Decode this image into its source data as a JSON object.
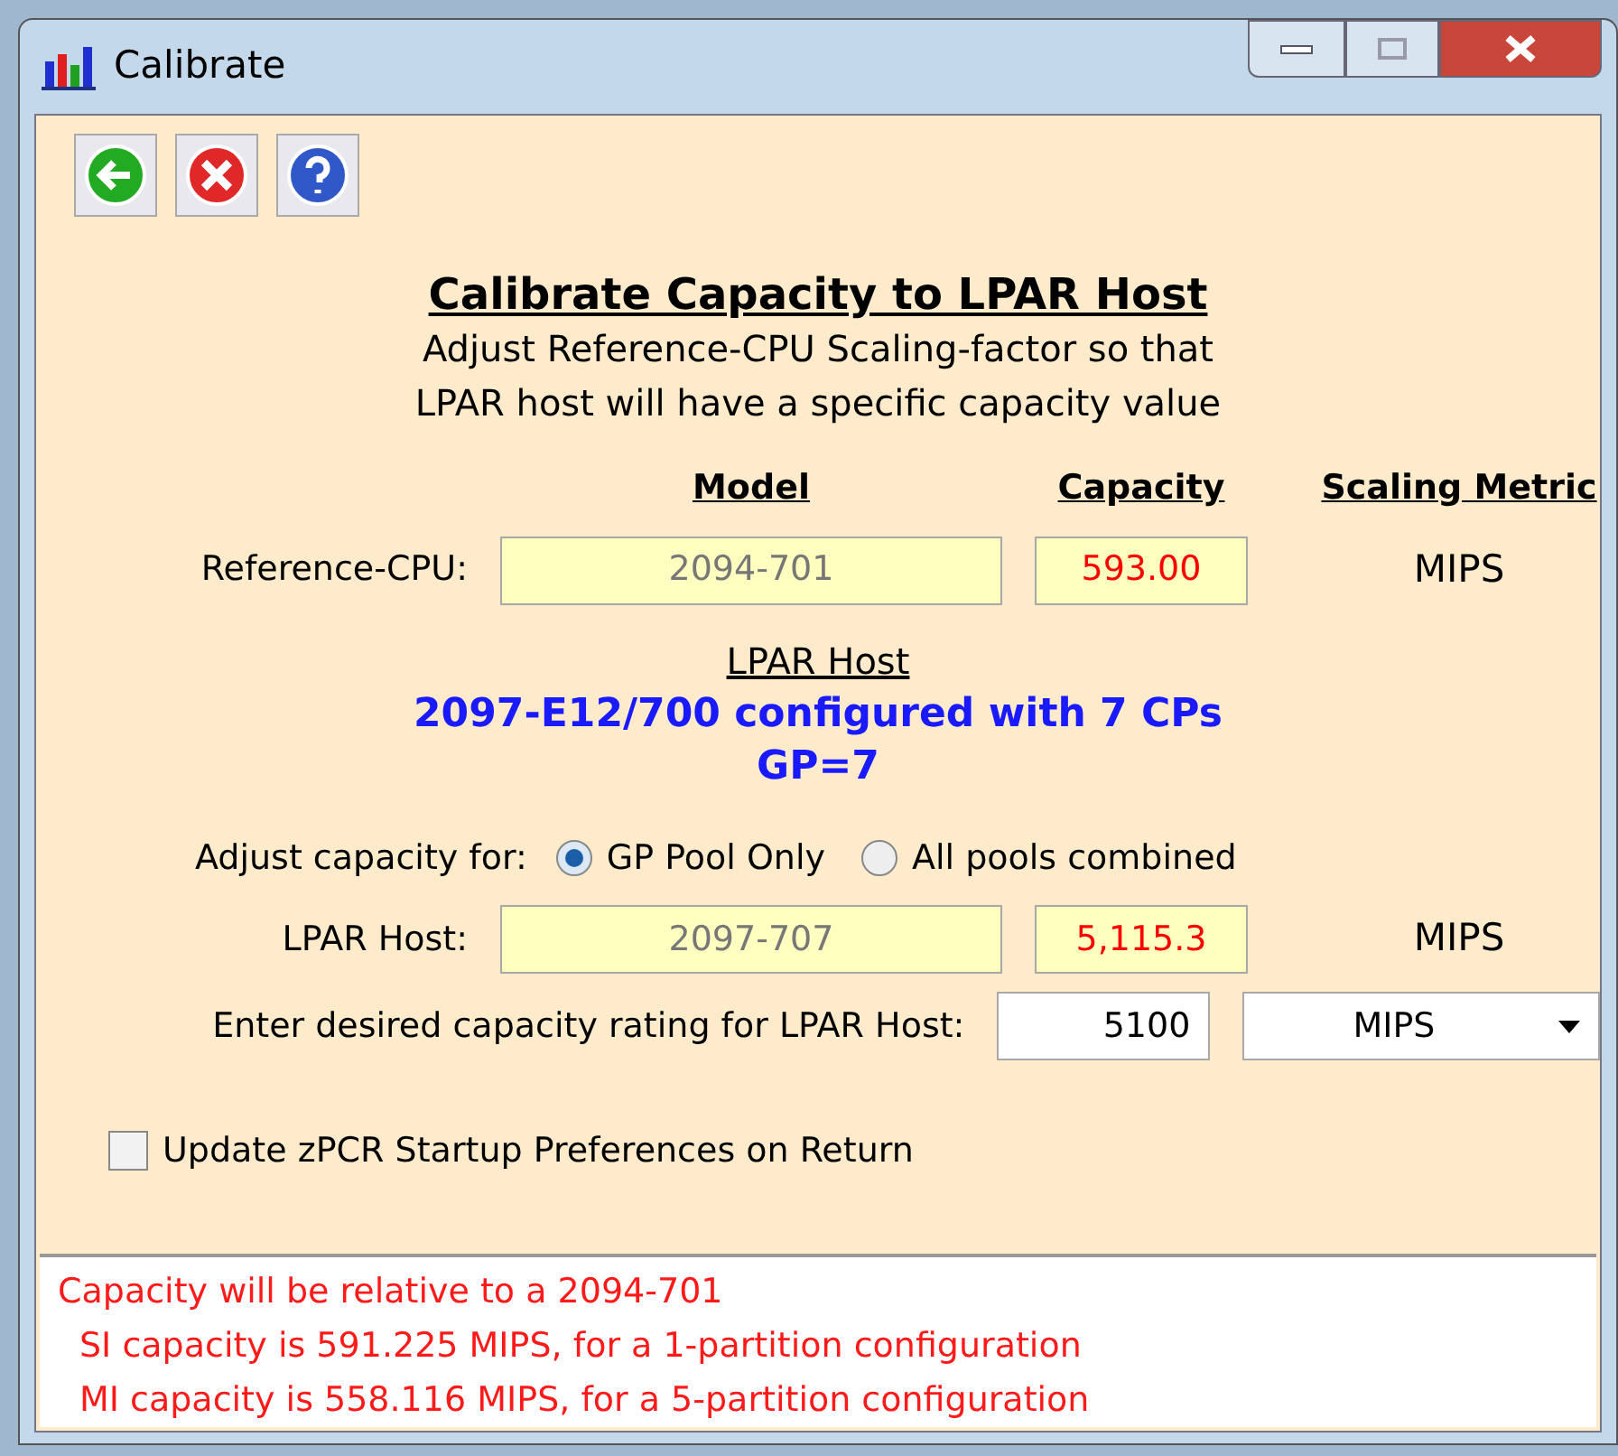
{
  "window": {
    "title": "Calibrate"
  },
  "heading": "Calibrate Capacity to LPAR Host",
  "subtitle": [
    "Adjust Reference-CPU Scaling-factor so that",
    "LPAR host will have a specific capacity value"
  ],
  "columns": [
    "Model",
    "Capacity",
    "Scaling Metric"
  ],
  "reference": {
    "label": "Reference-CPU:",
    "model": "2094-701",
    "capacity": "593.00",
    "metric": "MIPS"
  },
  "lpar_host": {
    "title": "LPAR Host",
    "config": "2097-E12/700 configured with 7 CPs",
    "pools": "GP=7"
  },
  "adjust": {
    "label": "Adjust capacity for:",
    "options": [
      {
        "label": "GP Pool Only",
        "selected": true
      },
      {
        "label": "All pools combined",
        "selected": false
      }
    ]
  },
  "host_row": {
    "label": "LPAR Host:",
    "model": "2097-707",
    "capacity": "5,115.3",
    "metric": "MIPS"
  },
  "desired": {
    "label": "Enter desired capacity rating for LPAR Host:",
    "value": "5100",
    "unit": "MIPS"
  },
  "update_prefs": {
    "label": "Update zPCR Startup Preferences on Return",
    "checked": false
  },
  "messages": [
    {
      "text": "Capacity will be relative to a 2094-701",
      "indented": false
    },
    {
      "text": "SI capacity is 591.225 MIPS, for a 1-partition configuration",
      "indented": true
    },
    {
      "text": "MI capacity is 558.116 MIPS, for a 5-partition configuration",
      "indented": true
    }
  ]
}
